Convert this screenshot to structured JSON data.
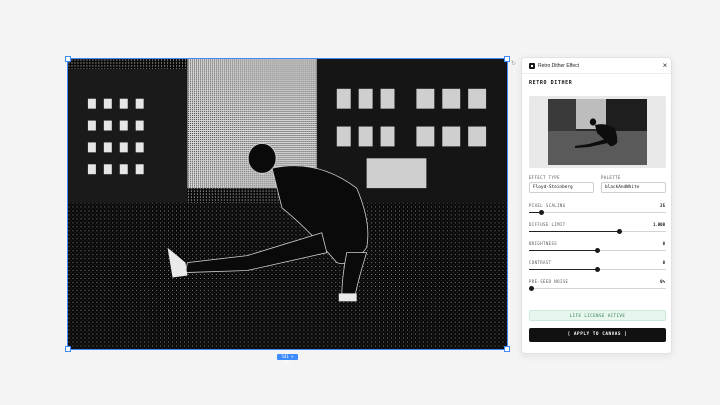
{
  "canvas": {
    "size_label": "541 × 361"
  },
  "panel": {
    "window_title": "Retro Dither Effect",
    "close_icon": "close-icon",
    "heading": "RETRO DITHER",
    "effect_type": {
      "label": "EFFECT TYPE",
      "value": "Floyd-Steinberg"
    },
    "palette": {
      "label": "PALETTE",
      "value": "blackAndWhite"
    },
    "sliders": [
      {
        "label": "PIXEL SCALING",
        "value": "25",
        "fraction": 0.09
      },
      {
        "label": "DIFFUSE LIMIT",
        "value": "1.000",
        "fraction": 0.66
      },
      {
        "label": "BRIGHTNESS",
        "value": "0",
        "fraction": 0.5
      },
      {
        "label": "CONTRAST",
        "value": "0",
        "fraction": 0.5
      },
      {
        "label": "PRE-SEED NOISE",
        "value": "0%",
        "fraction": 0.0
      }
    ],
    "license_status": "LIFE LICENSE ACTIVE",
    "apply_button": "[ APPLY TO CANVAS ]"
  },
  "colors": {
    "selection": "#3d8bfd",
    "button_bg": "#111111",
    "license_bg": "#e7f7ee",
    "license_text": "#2d7a4f"
  }
}
